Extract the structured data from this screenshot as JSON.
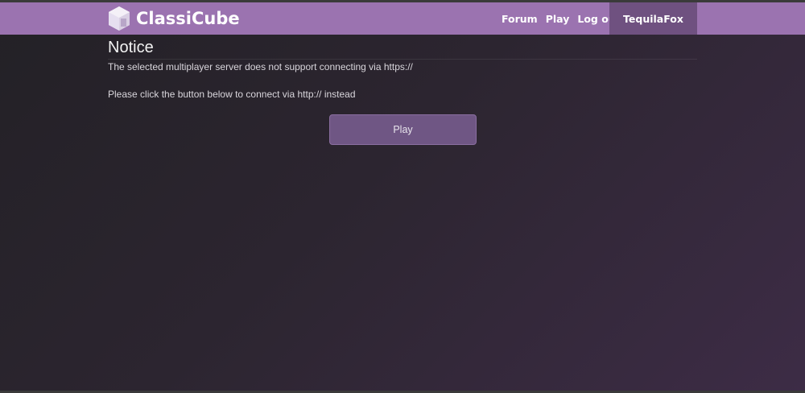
{
  "navbar": {
    "brand": "ClassiCube",
    "links": [
      {
        "label": "Forum"
      },
      {
        "label": "Play"
      },
      {
        "label": "Log out"
      }
    ],
    "username": "TequilaFox"
  },
  "notice": {
    "title": "Notice",
    "message1": "The selected multiplayer server does not support connecting via https://",
    "message2": "Please click the button below to connect via http:// instead",
    "button_label": "Play"
  },
  "colors": {
    "navbar": "#9b73b0",
    "user_box": "#6f5180",
    "button": "#6f5684"
  }
}
